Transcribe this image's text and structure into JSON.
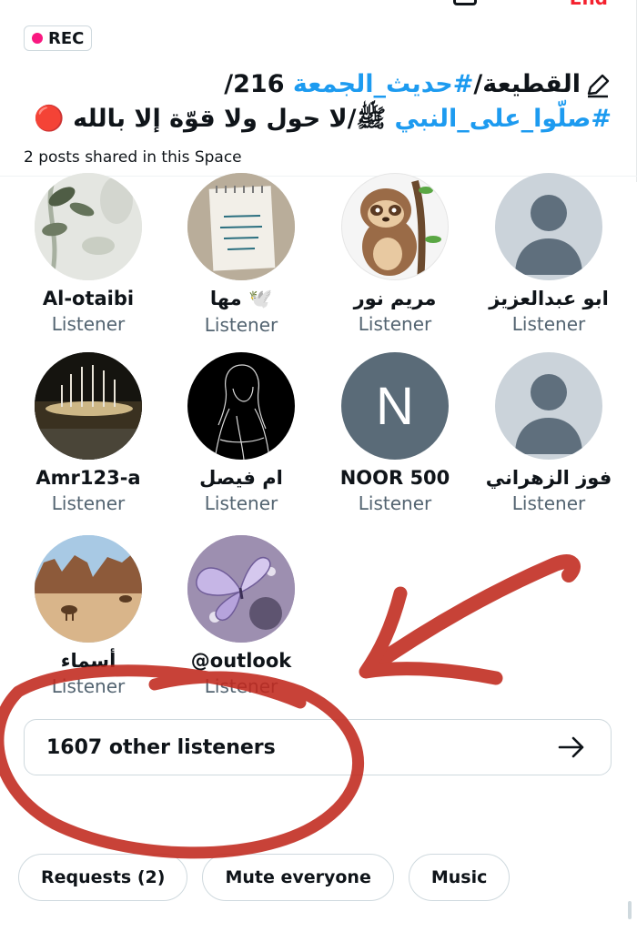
{
  "header": {
    "end_label": "End",
    "rec_label": "REC",
    "title_line1_tag": "#حديث_الجمعة",
    "title_line1_pre": "القطيعة/",
    "title_line1_post": " 216/",
    "title_line2_tag": "#صلّوا_على_النبي",
    "title_line2_text": " ﷺ/لا حول ولا قوّة إلا بالله",
    "title_line2_emoji": "🔴",
    "subtitle": "2 posts shared in this Space"
  },
  "listeners": [
    {
      "name": "ابو عبدالعزيز",
      "role": "Listener",
      "avatar": "default-avatar"
    },
    {
      "name": "مريم نور",
      "role": "Listener",
      "avatar": "sloth-avatar"
    },
    {
      "name": "مها 🕊️",
      "role": "Listener",
      "avatar": "notebook-avatar"
    },
    {
      "name": "Al-otaibi",
      "role": "Listener",
      "avatar": "plant-avatar"
    },
    {
      "name": "فوز الزهراني",
      "role": "Listener",
      "avatar": "default-avatar"
    },
    {
      "name": "NOOR 500",
      "role": "Listener",
      "avatar": "letter-avatar",
      "letter": "N"
    },
    {
      "name": "ام فيصل",
      "role": "Listener",
      "avatar": "sketch-avatar"
    },
    {
      "name": "Amr123-a",
      "role": "Listener",
      "avatar": "fountain-avatar"
    },
    {
      "name": "@outlook",
      "role": "Listener",
      "avatar": "butterfly-avatar"
    },
    {
      "name": "أسماء",
      "role": "Listener",
      "avatar": "desert-avatar"
    }
  ],
  "other_listeners": "1607 other listeners",
  "chips": [
    "Requests (2)",
    "Mute everyone",
    "Music"
  ],
  "colors": {
    "accent": "#1d9bf0",
    "rec_dot": "#f91880",
    "annotation": "#c0281c",
    "avatar_default": "#b9c3cb"
  }
}
